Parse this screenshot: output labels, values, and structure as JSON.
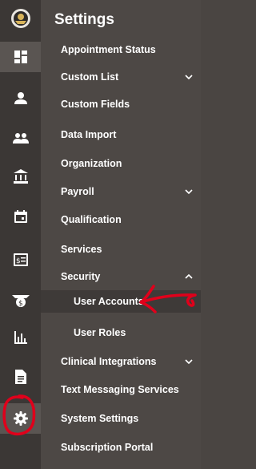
{
  "sidebar": {
    "title": "Settings",
    "rail_icons": [
      "logo-icon",
      "dashboard-icon",
      "person-icon",
      "people-icon",
      "bank-icon",
      "calendar-icon",
      "invoice-icon",
      "money-icon",
      "bar-chart-icon",
      "document-icon",
      "gear-icon"
    ],
    "items": [
      {
        "label": "Appointment Status"
      },
      {
        "label": "Custom List",
        "expandable": true
      },
      {
        "label": "Custom Fields"
      },
      {
        "label": "Data Import"
      },
      {
        "label": "Organization"
      },
      {
        "label": "Payroll",
        "expandable": true
      },
      {
        "label": "Qualification"
      },
      {
        "label": "Services"
      },
      {
        "label": "Security",
        "expanded": true,
        "children": [
          {
            "label": "User Accounts",
            "selected": true
          },
          {
            "label": "User Roles"
          }
        ]
      },
      {
        "label": "Clinical Integrations",
        "expandable": true
      },
      {
        "label": "Text Messaging Services"
      },
      {
        "label": "System Settings"
      },
      {
        "label": "Subscription Portal"
      }
    ]
  },
  "colors": {
    "rail": "#3b3735",
    "panel": "#4d4845",
    "selected": "#3e3a38",
    "annotation": "#e0001b"
  }
}
